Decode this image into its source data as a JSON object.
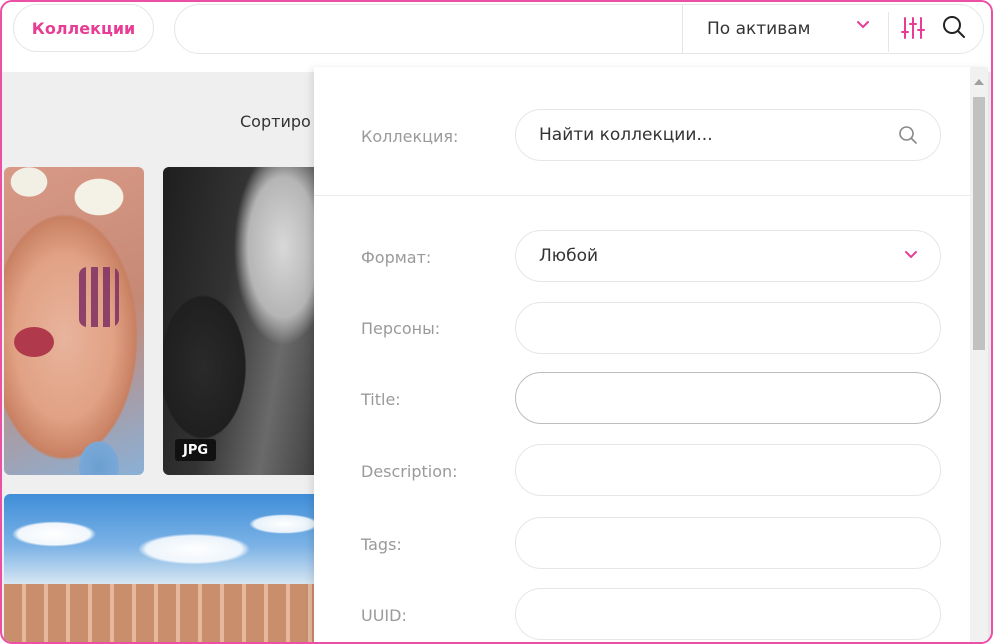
{
  "topbar": {
    "collections_label": "Коллекции",
    "assets_select_value": "По активам"
  },
  "sort_label": "Сортиро",
  "cards": [
    {
      "badge": ""
    },
    {
      "badge": "JPG"
    },
    {
      "badge": ""
    }
  ],
  "filter_panel": {
    "collection_label": "Коллекция:",
    "collection_placeholder": "Найти коллекции...",
    "format_label": "Формат:",
    "format_value": "Любой",
    "persons_label": "Персоны:",
    "title_label": "Title:",
    "description_label": "Description:",
    "tags_label": "Tags:",
    "uuid_label": "UUID:"
  },
  "colors": {
    "accent": "#e83d95",
    "frame": "#ec4fa6"
  }
}
